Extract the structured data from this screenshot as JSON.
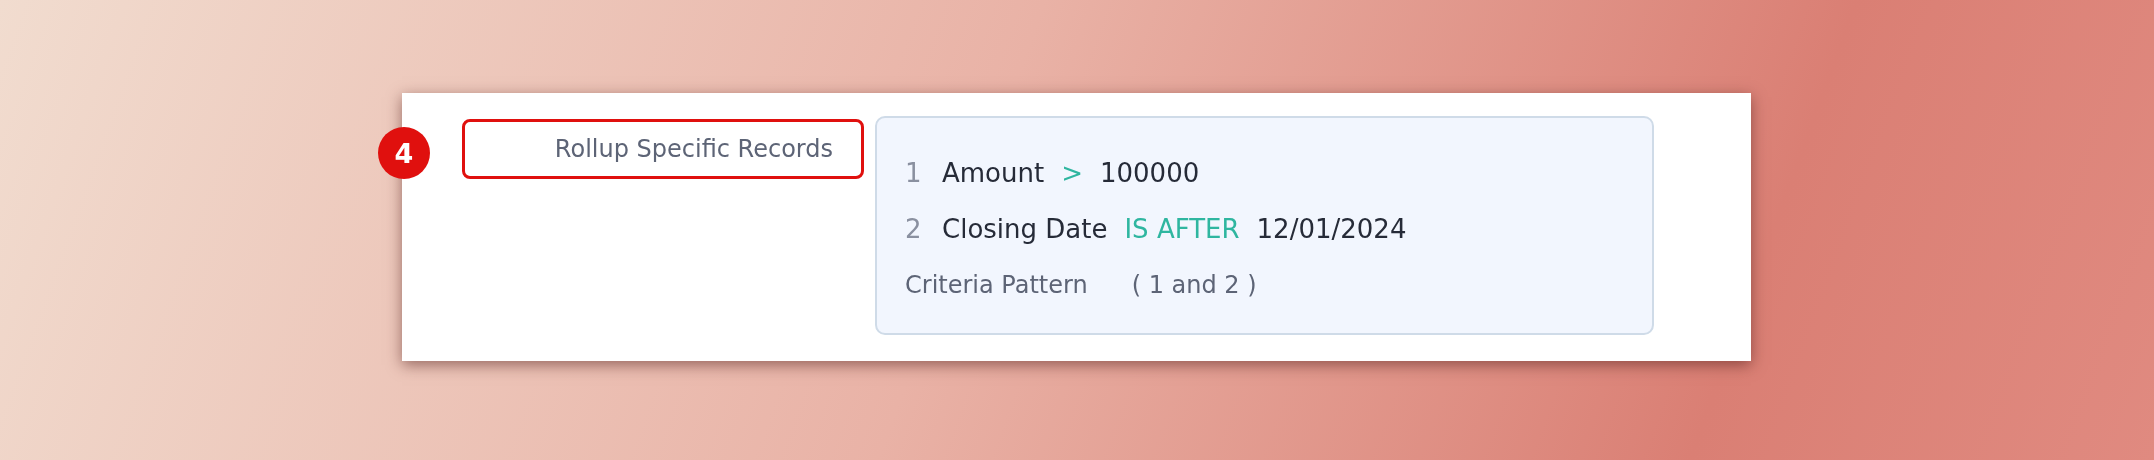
{
  "step_badge": "4",
  "option_label": "Rollup Specific Records",
  "criteria": [
    {
      "index": "1",
      "field": "Amount",
      "operator": ">",
      "value": "100000"
    },
    {
      "index": "2",
      "field": "Closing Date",
      "operator": "IS AFTER",
      "value": "12/01/2024"
    }
  ],
  "criteria_pattern": {
    "label": "Criteria Pattern",
    "value": "( 1 and 2 )"
  }
}
